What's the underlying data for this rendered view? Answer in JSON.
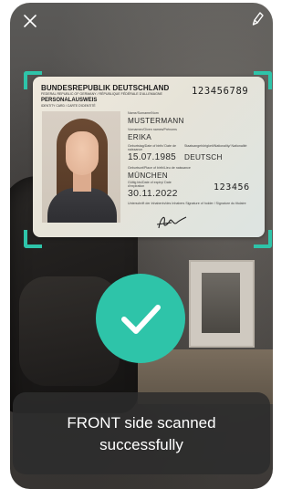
{
  "icons": {
    "close": "close-icon",
    "flash": "flash-icon",
    "success": "checkmark-icon"
  },
  "colors": {
    "accent": "#2ec4a9",
    "toast_bg": "#2c2c2c",
    "toast_text": "#ffffff"
  },
  "card": {
    "country_title": "BUNDESREPUBLIK DEUTSCHLAND",
    "country_sub_1": "FEDERAL REPUBLIC OF GERMANY / RÉPUBLIQUE FÉDÉRALE D'ALLEMAGNE",
    "type_title": "PERSONALAUSWEIS",
    "type_sub": "IDENTITY CARD / CARTE D'IDENTITÉ",
    "document_number": "123456789",
    "surname_label": "Name/Surname/Nom",
    "surname": "MUSTERMANN",
    "given_names_label": "Vornamen/Given names/Prénoms",
    "given_names": "ERIKA",
    "dob_label": "Geburtstag/Date of birth/ Date de naissance",
    "dob": "15.07.1985",
    "nationality_label": "Staatsangehörigkeit/Nationality/ Nationalité",
    "nationality": "DEUTSCH",
    "pob_label": "Geburtsort/Place of birth/Lieu de naissance",
    "pob": "MÜNCHEN",
    "expiry_label": "Gültig bis/Date of expiry/ Date d'expiration",
    "expiry": "30.11.2022",
    "can": "123456",
    "signature_label": "Unterschrift der Inhaberin/des Inhabers Signature of holder / Signature du titulaire"
  },
  "message": {
    "text": "FRONT side scanned successfully"
  }
}
